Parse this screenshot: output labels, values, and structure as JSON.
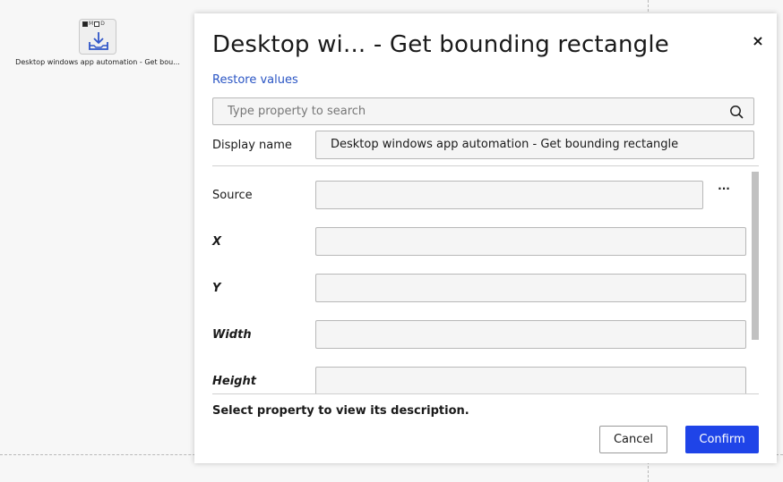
{
  "canvas": {
    "node": {
      "flags": [
        {
          "label": "",
          "checked": true
        },
        {
          "label": "M",
          "checked": false
        },
        {
          "label": "D",
          "checked": false
        }
      ],
      "icon": "download-tray-icon",
      "label": "Desktop windows app automation - Get bou..."
    }
  },
  "dialog": {
    "title": "Desktop wi... - Get bounding rectangle",
    "close_label": "×",
    "restore_label": "Restore values",
    "search": {
      "placeholder": "Type property to search",
      "value": ""
    },
    "display_name": {
      "label": "Display name",
      "value": "Desktop windows app automation - Get bounding rectangle"
    },
    "properties": [
      {
        "label": "Source",
        "value": "",
        "required": false
      },
      {
        "label": "X",
        "value": "",
        "required": true
      },
      {
        "label": "Y",
        "value": "",
        "required": true
      },
      {
        "label": "Width",
        "value": "",
        "required": true
      },
      {
        "label": "Height",
        "value": "",
        "required": true
      }
    ],
    "source_more_label": "···",
    "description": "Select property to view its description.",
    "buttons": {
      "cancel": "Cancel",
      "confirm": "Confirm"
    }
  },
  "colors": {
    "accent": "#1f44e8",
    "link": "#2a55c4",
    "field_bg": "#f5f5f5",
    "field_border": "#b8b8b8"
  }
}
